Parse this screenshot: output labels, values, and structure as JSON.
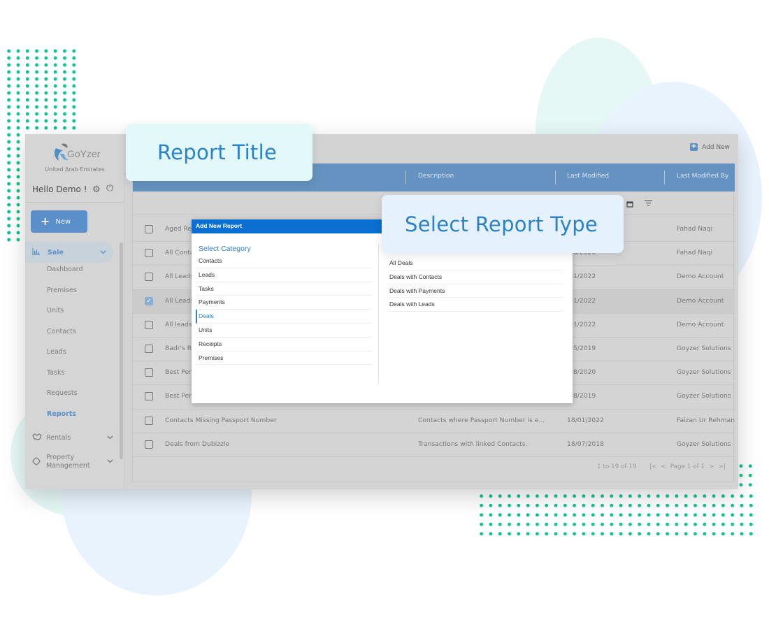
{
  "callouts": {
    "report_title": "Report Title",
    "select_report_type": "Select Report Type"
  },
  "sidebar": {
    "brand": "GoYzer",
    "region": "United Arab Emirates",
    "greeting": "Hello Demo !",
    "icons": {
      "settings": "⚙",
      "power": "⏻"
    },
    "new_button": {
      "icon": "+",
      "label": "New"
    },
    "sale": {
      "icon": "📊",
      "label": "Sale",
      "chevron": "⌄"
    },
    "sale_items": [
      {
        "label": "Dashboard"
      },
      {
        "label": "Premises"
      },
      {
        "label": "Units"
      },
      {
        "label": "Contacts"
      },
      {
        "label": "Leads"
      },
      {
        "label": "Tasks"
      },
      {
        "label": "Requests"
      },
      {
        "label": "Reports",
        "active": true
      }
    ],
    "groups": [
      {
        "icon": "🤝",
        "label": "Rentals",
        "chevron": "⌄"
      },
      {
        "icon": "✿",
        "label": "Property\nManagement",
        "chevron": "⌄"
      }
    ]
  },
  "toolbar": {
    "add_new_icon": "+",
    "add_new_label": "Add New"
  },
  "grid": {
    "columns": {
      "description": "Description",
      "last_modified": "Last Modified",
      "last_modified_by": "Last Modified By"
    },
    "filter_icons": {
      "calendar": "🗓",
      "filter": "≡"
    },
    "rows": [
      {
        "title": "Aged Re",
        "description": "",
        "date": "",
        "by": "Fahad Naqi",
        "checked": false
      },
      {
        "title": "All Conta",
        "description": "",
        "date": "/10/2020",
        "by": "Fahad Naqi",
        "checked": false
      },
      {
        "title": "All Leads",
        "description": "",
        "date": "/01/2022",
        "by": "Demo Account",
        "checked": false
      },
      {
        "title": "All Leads",
        "description": "",
        "date": "/01/2022",
        "by": "Demo Account",
        "checked": true
      },
      {
        "title": "All leads",
        "description": "",
        "date": "/01/2022",
        "by": "Demo Account",
        "checked": false
      },
      {
        "title": "Badr's Re",
        "description": "",
        "date": "/05/2019",
        "by": "Goyzer Solutions",
        "checked": false
      },
      {
        "title": "Best Perf",
        "description": "",
        "date": "/08/2020",
        "by": "Goyzer Solutions",
        "checked": false
      },
      {
        "title": "Best Perf",
        "description": "",
        "date": "/08/2019",
        "by": "Goyzer Solutions",
        "checked": false
      },
      {
        "title": "Contacts Missing Passport Number",
        "description": "Contacts where Passport Number is e...",
        "date": "18/01/2022",
        "by": "Faizan Ur Rehman",
        "checked": false
      },
      {
        "title": "Deals from Dubizzle",
        "description": "Transactions with linked Contacts.",
        "date": "18/07/2018",
        "by": "Goyzer Solutions",
        "checked": false
      }
    ],
    "pager": {
      "count": "1 to 19 of 19",
      "first": "|<",
      "prev": "<",
      "page": "Page 1 of 1",
      "next": ">",
      "last": ">|"
    }
  },
  "modal": {
    "title": "Add New Report",
    "category_heading": "Select Category",
    "categories": [
      {
        "label": "Contacts"
      },
      {
        "label": "Leads"
      },
      {
        "label": "Tasks"
      },
      {
        "label": "Payments"
      },
      {
        "label": "Deals",
        "active": true
      },
      {
        "label": "Units"
      },
      {
        "label": "Receipts"
      },
      {
        "label": "Premises"
      }
    ],
    "report_types": [
      {
        "label": "All Deals"
      },
      {
        "label": "Deals with Contacts"
      },
      {
        "label": "Deals with Payments"
      },
      {
        "label": "Deals with Leads"
      }
    ]
  }
}
